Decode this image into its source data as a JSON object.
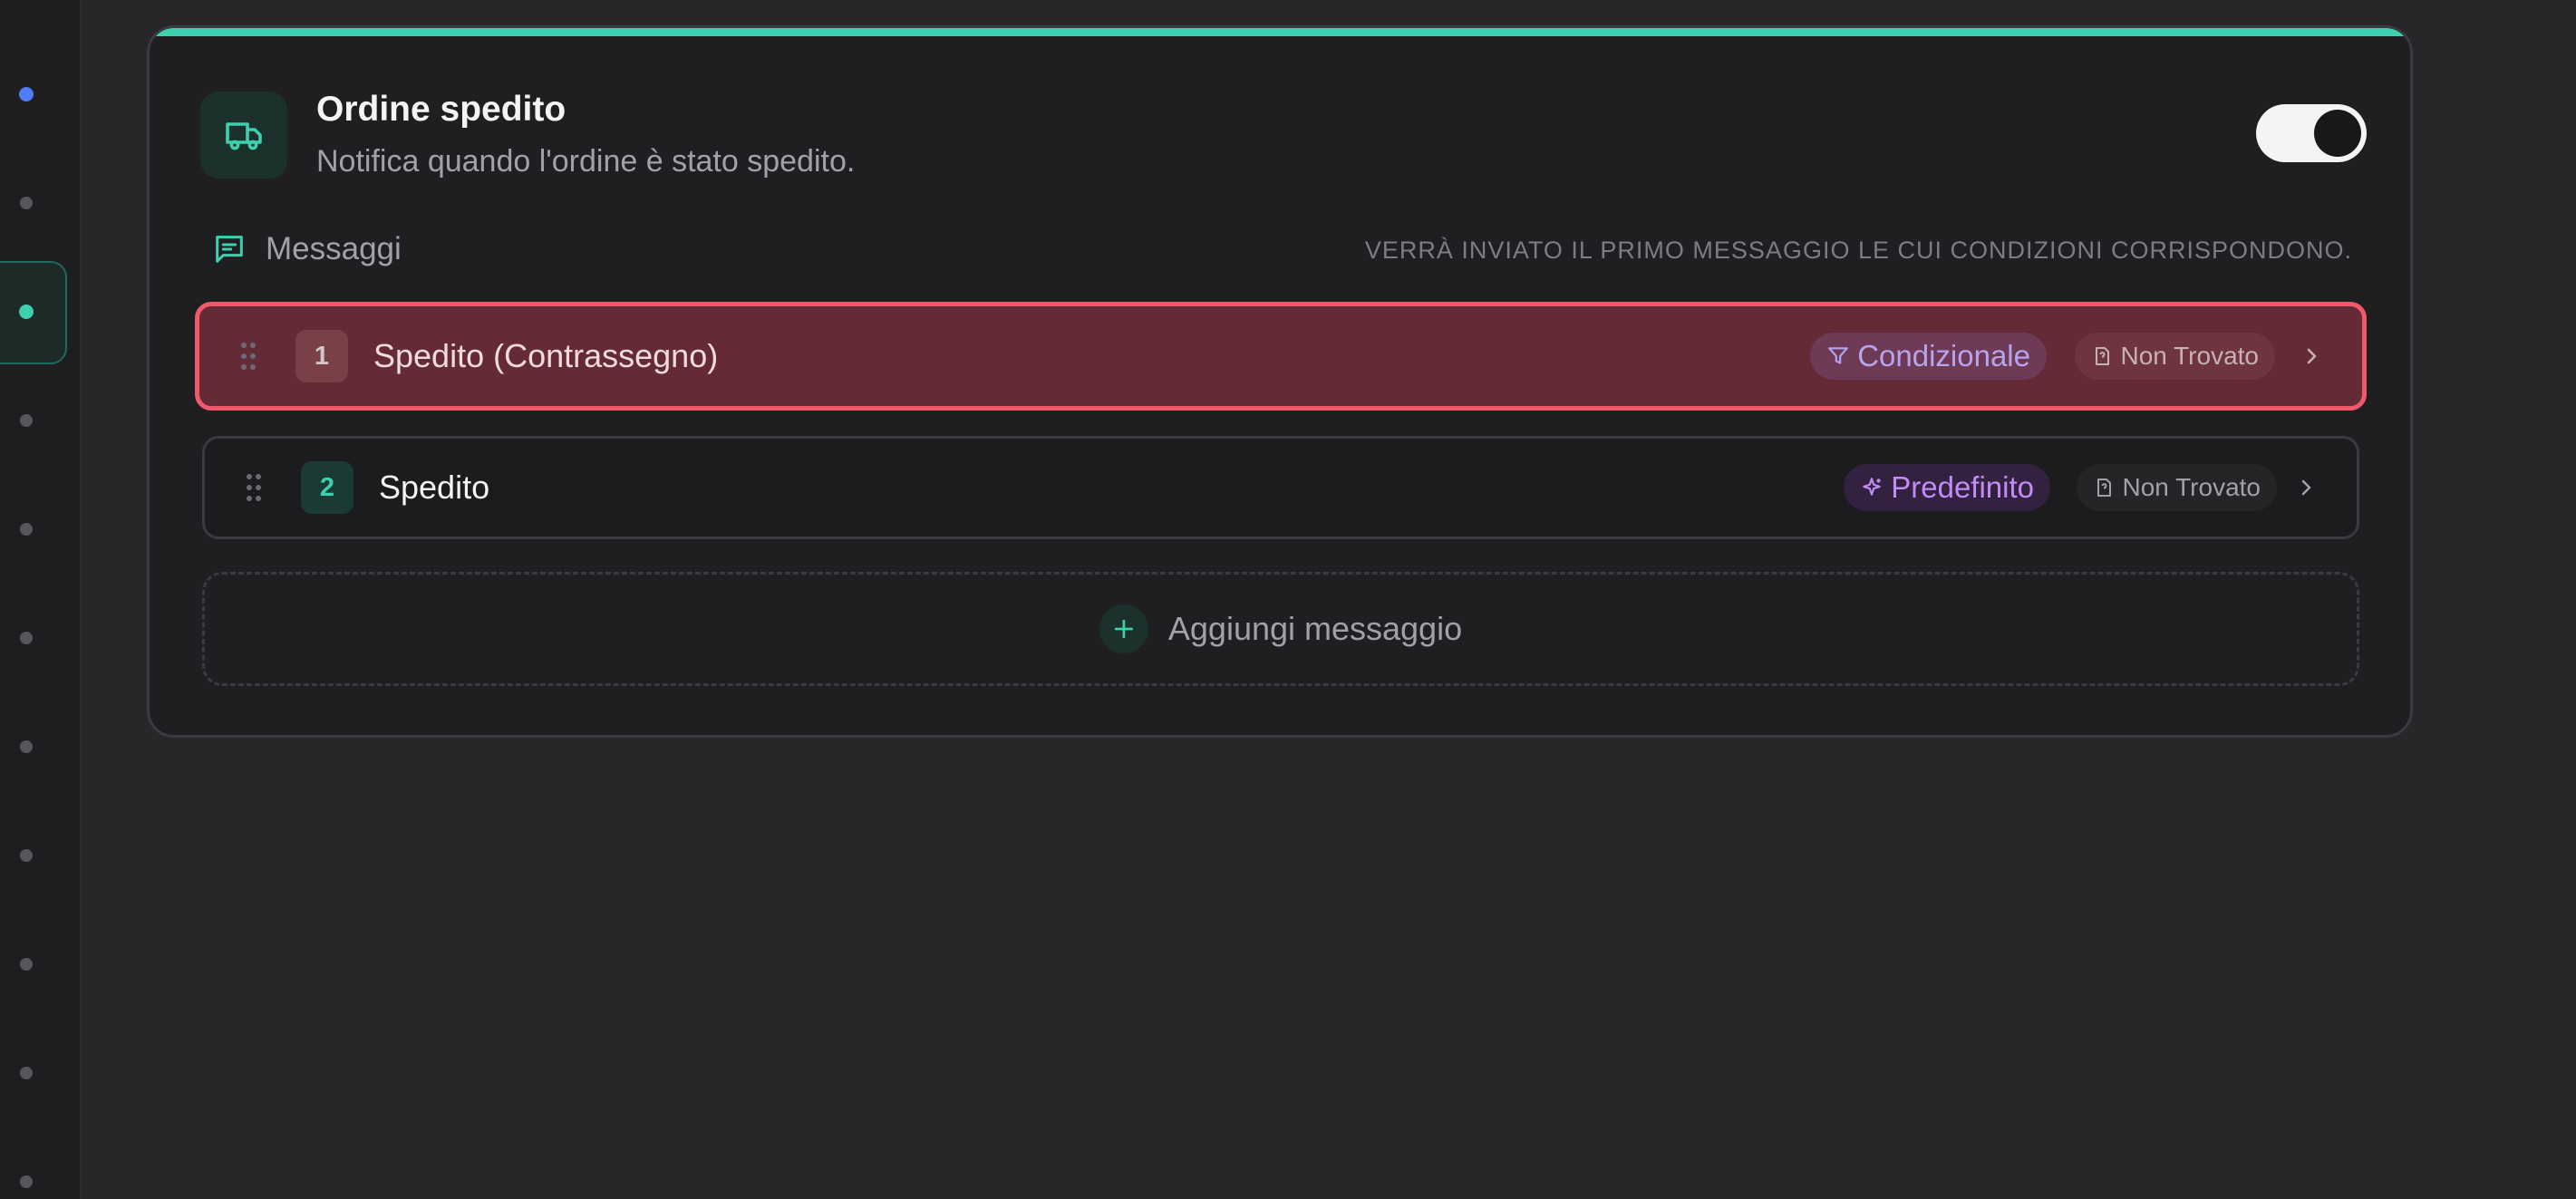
{
  "card": {
    "title": "Ordine spedito",
    "subtitle": "Notifica quando l'ordine è stato spedito.",
    "toggle_on": true,
    "accent": "#3ecfae",
    "icon": "truck-icon"
  },
  "messages_section": {
    "label": "Messaggi",
    "hint": "VERRÀ INVIATO IL PRIMO MESSAGGIO LE CUI CONDIZIONI CORRISPONDONO.",
    "icon": "message-square-icon"
  },
  "messages": [
    {
      "number": "1",
      "name": "Spedito (Contrassegno)",
      "type_label": "Condizionale",
      "type_icon": "filter-icon",
      "status_label": "Non Trovato",
      "status_icon": "file-question-icon",
      "highlighted": true
    },
    {
      "number": "2",
      "name": "Spedito",
      "type_label": "Predefinito",
      "type_icon": "sparkles-icon",
      "status_label": "Non Trovato",
      "status_icon": "file-question-icon",
      "highlighted": false
    }
  ],
  "add_message": {
    "label": "Aggiungi messaggio",
    "icon": "plus-icon"
  },
  "colors": {
    "highlight_border": "#ee5a6c",
    "highlight_bg": "#642b37",
    "conditional": "#b6a4ef",
    "default": "#c38bf5",
    "rail_active_blue": "#4f7cf7"
  }
}
